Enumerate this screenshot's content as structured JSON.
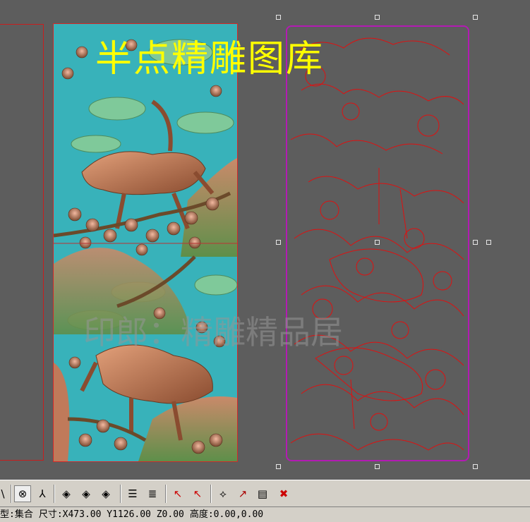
{
  "watermarks": {
    "top": "半点精雕图库",
    "middle": "印郎：精雕精品居"
  },
  "toolbar": {
    "buttons": [
      {
        "name": "node-select-tool-icon",
        "glyph": "\\",
        "pressed": false
      },
      {
        "name": "snap-point-icon",
        "glyph": "⊗",
        "pressed": true
      },
      {
        "name": "snap-angle-icon",
        "glyph": "⅄",
        "pressed": false
      },
      {
        "name": "node-diamond-1-icon",
        "glyph": "◈",
        "pressed": false
      },
      {
        "name": "node-diamond-2-icon",
        "glyph": "◈",
        "pressed": false
      },
      {
        "name": "node-diamond-3-icon",
        "glyph": "◈",
        "pressed": false
      },
      {
        "name": "layer-lines-icon",
        "glyph": "☰",
        "pressed": false
      },
      {
        "name": "layer-merge-icon",
        "glyph": "≣",
        "pressed": false
      },
      {
        "name": "pointer-add-icon",
        "glyph": "↖",
        "pressed": false
      },
      {
        "name": "pointer-remove-icon",
        "glyph": "↖",
        "pressed": false
      },
      {
        "name": "edit-path-icon",
        "glyph": "⟡",
        "pressed": false
      },
      {
        "name": "curve-edit-icon",
        "glyph": "↗",
        "pressed": false
      },
      {
        "name": "document-edit-icon",
        "glyph": "▤",
        "pressed": false
      },
      {
        "name": "delete-icon",
        "glyph": "✖",
        "pressed": false
      }
    ]
  },
  "status": {
    "type_label": "型:集合",
    "size_label": "尺寸:X473.00 Y1126.00 Z0.00",
    "height_label": "高度:0.00,0.00"
  },
  "colors": {
    "background": "#5d5d5d",
    "selection_border": "#b31bb3",
    "vector_line": "#e01010",
    "watermark_yellow": "#ffff00",
    "delete_red": "#cc0000"
  }
}
